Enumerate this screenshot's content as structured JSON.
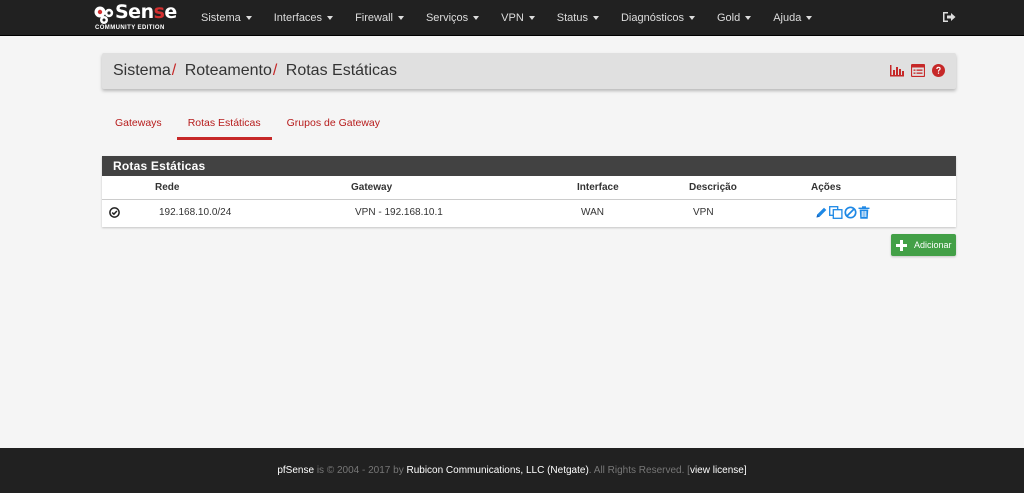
{
  "navbar": {
    "brand": {
      "logo_main": "Sen",
      "logo_red": "s",
      "logo_end": "e",
      "edition": "COMMUNITY EDITION"
    },
    "items": [
      {
        "label": "Sistema"
      },
      {
        "label": "Interfaces"
      },
      {
        "label": "Firewall"
      },
      {
        "label": "Serviços"
      },
      {
        "label": "VPN"
      },
      {
        "label": "Status"
      },
      {
        "label": "Diagnósticos"
      },
      {
        "label": "Gold"
      },
      {
        "label": "Ajuda"
      }
    ],
    "logout_icon": "sign-out-icon"
  },
  "breadcrumb": {
    "items": [
      "Sistema",
      "Roteamento",
      "Rotas Estáticas"
    ],
    "separator": "/",
    "icons": [
      "bar-chart-icon",
      "list-alt-icon",
      "help-icon"
    ]
  },
  "tabs": [
    {
      "label": "Gateways",
      "active": false
    },
    {
      "label": "Rotas Estáticas",
      "active": true
    },
    {
      "label": "Grupos de Gateway",
      "active": false
    }
  ],
  "table": {
    "title": "Rotas Estáticas",
    "columns": [
      "",
      "Rede",
      "Gateway",
      "Interface",
      "Descrição",
      "Ações"
    ],
    "rows": [
      {
        "status_icon": "check-circle-icon",
        "rede": "192.168.10.0/24",
        "gateway": "VPN - 192.168.10.1",
        "interface": "WAN",
        "descricao": "VPN",
        "actions": [
          "edit-icon",
          "copy-icon",
          "disable-icon",
          "trash-icon"
        ]
      }
    ]
  },
  "add_button": {
    "label": "Adicionar"
  },
  "footer": {
    "brand": "pfSense",
    "t1": " is © 2004 - 2017 by ",
    "company": "Rubicon Communications, LLC (Netgate)",
    "t2": ". All Rights Reserved. [",
    "license": "view license",
    "t3": "]"
  },
  "colors": {
    "navbar_bg": "#212121",
    "accent_red": "#c62828",
    "panel_heading_bg": "#424242",
    "add_button_green": "#43a047",
    "action_blue": "#1e88e5"
  }
}
